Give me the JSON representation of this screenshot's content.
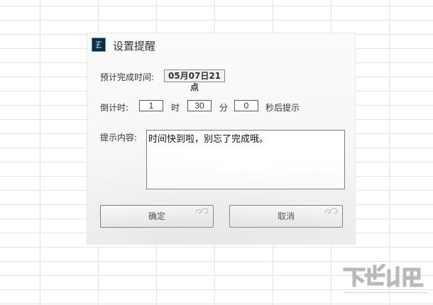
{
  "dialog": {
    "title": "设置提醒",
    "icon": "app-logo-icon",
    "estimated_label": "预计完成时间:",
    "estimated_value": "05月07日21点",
    "countdown_label": "倒计时:",
    "hours_value": "1",
    "hours_unit": "时",
    "minutes_value": "30",
    "minutes_unit": "分",
    "seconds_value": "0",
    "seconds_suffix": "秒后提示",
    "content_label": "提示内容:",
    "content_value": "时间快到啦，别忘了完成哦。",
    "ok_label": "确定",
    "cancel_label": "取消"
  },
  "colors": {
    "icon_bg": "#1a2a3a",
    "icon_accent": "#3aa0c8"
  },
  "watermark": {
    "icon": "site-watermark-icon"
  }
}
